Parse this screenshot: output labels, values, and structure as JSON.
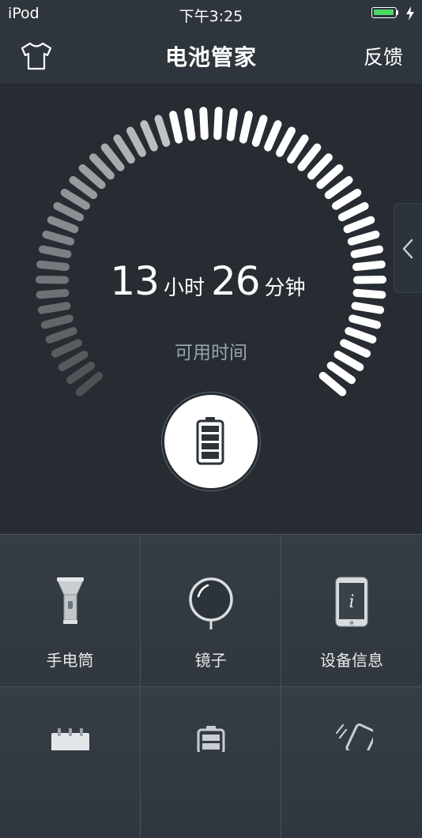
{
  "status_bar": {
    "carrier": "iPod",
    "time": "下午3:25",
    "battery_color": "#4cd964"
  },
  "nav": {
    "title": "电池管家",
    "feedback_label": "反馈",
    "left_icon": "shirt-icon"
  },
  "gauge": {
    "hours": "13",
    "hours_unit": "小时",
    "minutes": "26",
    "minutes_unit": "分钟",
    "caption": "可用时间",
    "center_icon": "battery-icon",
    "side_tab_icon": "chevron-left-icon"
  },
  "tools": [
    {
      "label": "手电筒",
      "icon": "flashlight-icon"
    },
    {
      "label": "镜子",
      "icon": "mirror-icon"
    },
    {
      "label": "设备信息",
      "icon": "device-info-icon"
    },
    {
      "label": "",
      "icon": "calendar-icon"
    },
    {
      "label": "",
      "icon": "battery-icon"
    },
    {
      "label": "",
      "icon": "tilt-phone-icon"
    }
  ]
}
